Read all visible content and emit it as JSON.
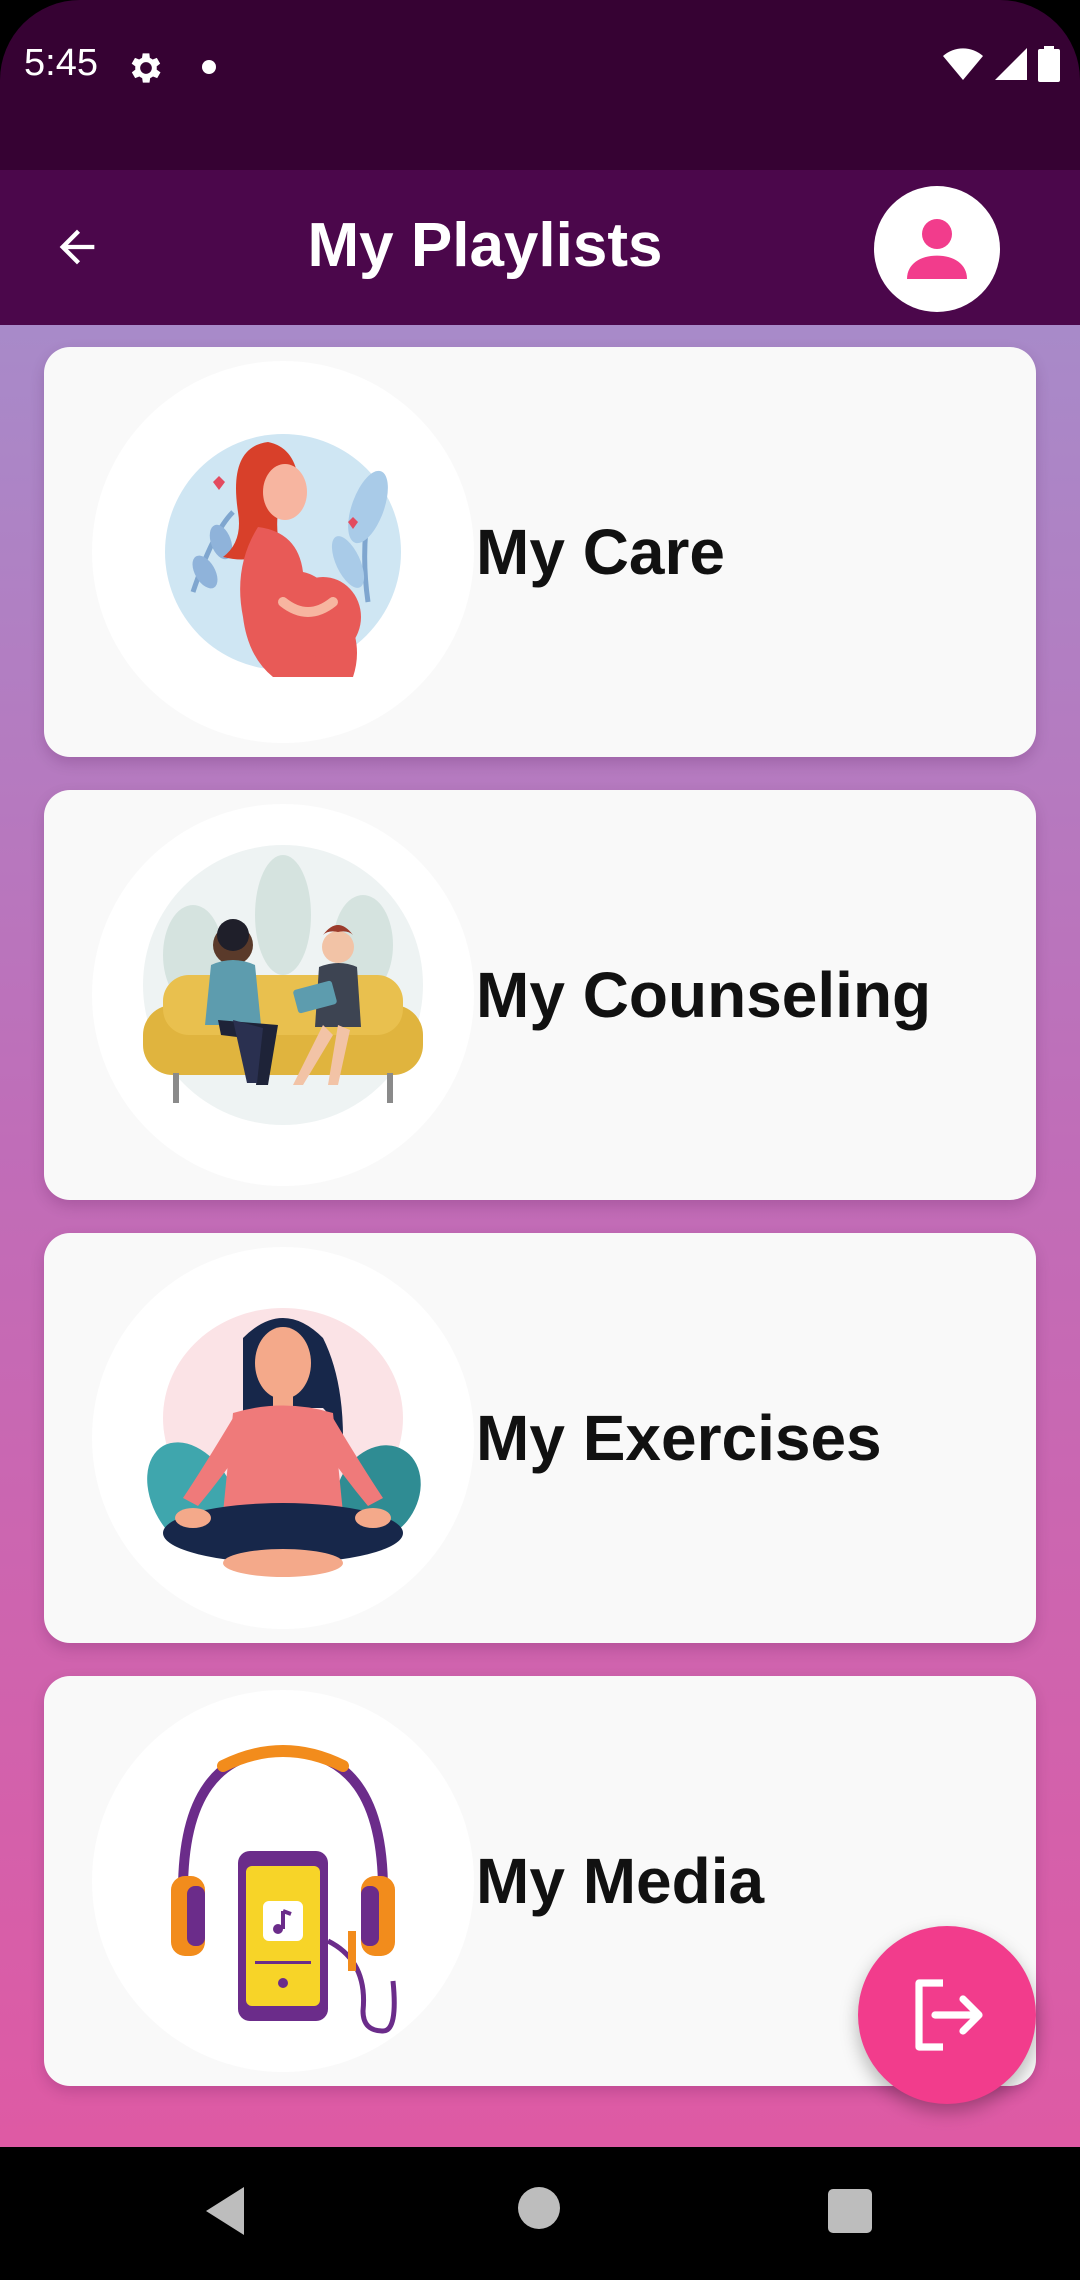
{
  "status_bar": {
    "time": "5:45",
    "icons": [
      "gear-icon",
      "notification-dot-icon",
      "wifi-icon",
      "signal-icon",
      "battery-icon"
    ]
  },
  "app_bar": {
    "title": "My Playlists",
    "back_icon": "arrow-left-icon",
    "profile_icon": "person-icon"
  },
  "colors": {
    "status_bar": "#360233",
    "app_bar": "#4b074b",
    "accent": "#f23c8c",
    "gradient_top": "#a88ac9",
    "gradient_bottom": "#de5aa4",
    "card": "#f9f9f9"
  },
  "playlists": [
    {
      "label": "My Care",
      "illustration": "pregnant-woman-illustration"
    },
    {
      "label": "My Counseling",
      "illustration": "counseling-session-illustration"
    },
    {
      "label": "My Exercises",
      "illustration": "meditation-yoga-illustration"
    },
    {
      "label": "My Media",
      "illustration": "headphones-phone-music-illustration"
    }
  ],
  "fab": {
    "icon": "logout-icon"
  },
  "nav_bar": {
    "icons": [
      "nav-back-icon",
      "nav-home-icon",
      "nav-recents-icon"
    ]
  }
}
